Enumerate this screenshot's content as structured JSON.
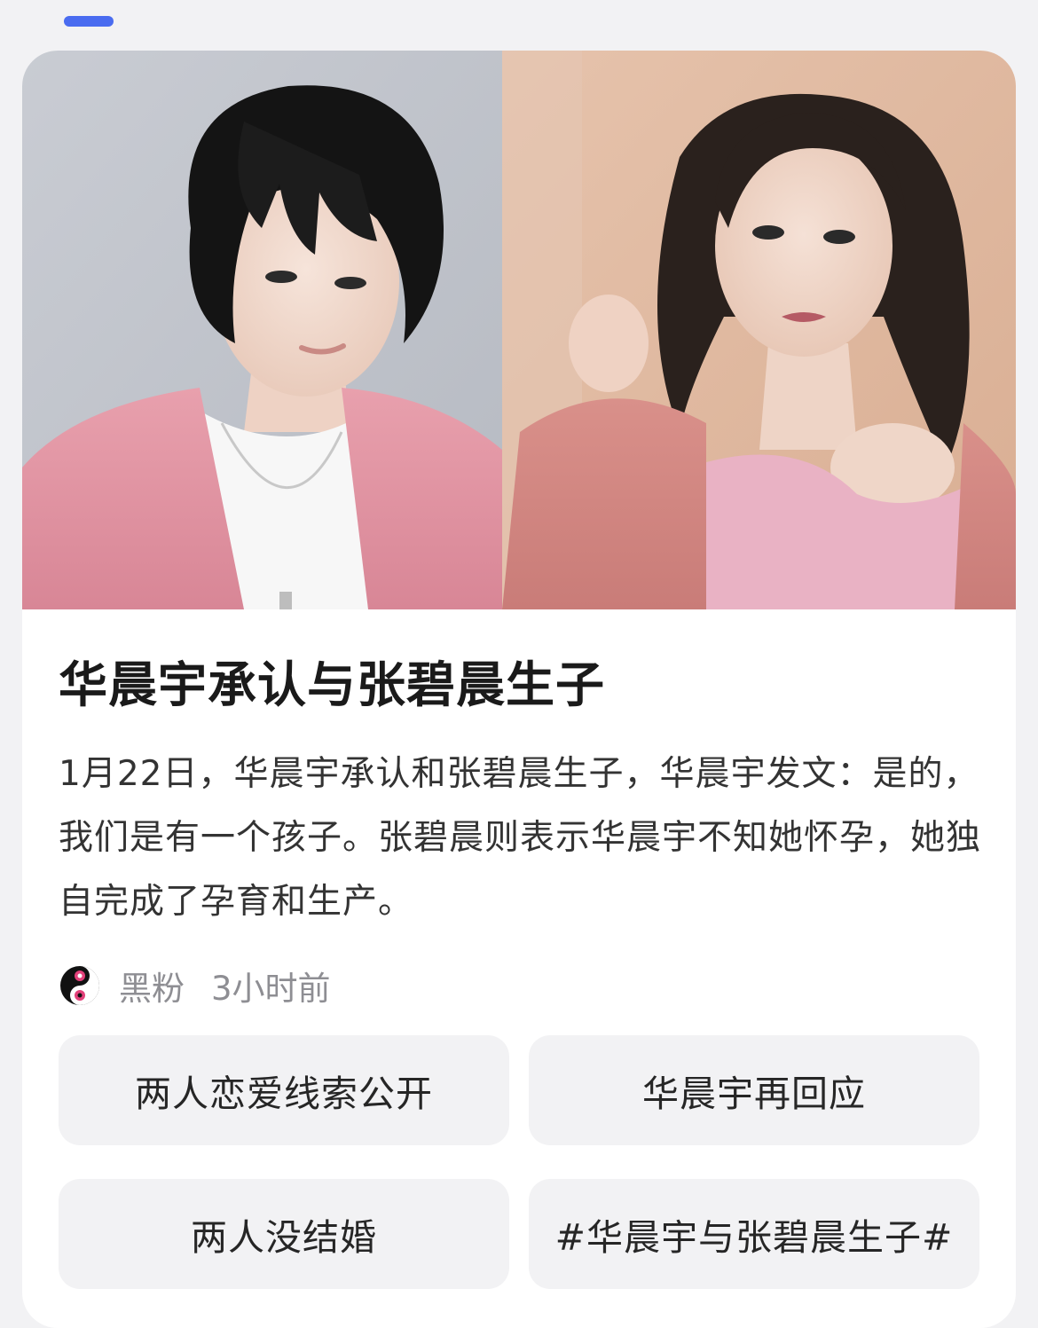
{
  "header": {
    "indicator_color": "#4a6cf0"
  },
  "hero": {
    "left_photo": "man-portrait-image",
    "right_photo": "woman-portrait-image"
  },
  "article": {
    "title": "华晨宇承认与张碧晨生子",
    "summary": "1月22日，华晨宇承认和张碧晨生子，华晨宇发文：是的，我们是有一个孩子。张碧晨则表示华晨宇不知她怀孕，她独自完成了孕育和生产。",
    "source": {
      "name": "黑粉",
      "time": "3小时前",
      "avatar_icon": "source-avatar-icon"
    }
  },
  "related_tags": [
    {
      "label": "两人恋爱线索公开"
    },
    {
      "label": "华晨宇再回应"
    },
    {
      "label": "两人没结婚"
    },
    {
      "label": "#华晨宇与张碧晨生子#"
    }
  ]
}
